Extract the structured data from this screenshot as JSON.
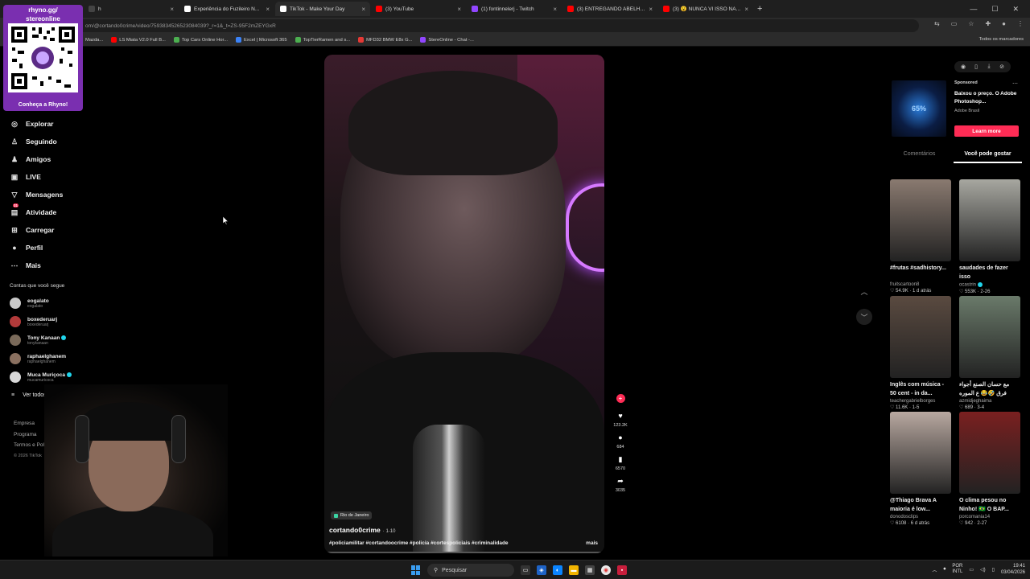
{
  "browser": {
    "tabs": [
      {
        "title": "h",
        "color": "#444444",
        "active": false
      },
      {
        "title": "Experiência do Fuzileiro N...",
        "color": "#ffffff",
        "active": false,
        "icon": "tiktok-icon"
      },
      {
        "title": "TikTok - Make Your Day",
        "color": "#ffffff",
        "active": true,
        "icon": "tiktok-icon"
      },
      {
        "title": "(3) YouTube",
        "color": "#ff0000",
        "active": false,
        "icon": "youtube-icon"
      },
      {
        "title": "(1) fontinnelerj - Twitch",
        "color": "#9146ff",
        "active": false,
        "icon": "twitch-icon"
      },
      {
        "title": "(3) ENTREGANDO ABELHAS, S...",
        "color": "#ff0000",
        "active": false,
        "icon": "youtube-icon"
      },
      {
        "title": "(3) 😮 NUNCA VI ISSO NA EXI...",
        "color": "#ff0000",
        "active": false,
        "icon": "youtube-icon"
      }
    ],
    "url": "om/@cortando0crime/video/7593834526523084039?_r=1&_t=ZS-95F2mZEYGxR",
    "bookmarks": [
      {
        "label": "Mazda...",
        "color": "#888888"
      },
      {
        "label": "LS Miata V2.0 Full B...",
        "color": "#ff0000"
      },
      {
        "label": "Top Cars Online Hor...",
        "color": "#4caf50"
      },
      {
        "label": "Excel | Microsoft 365",
        "color": "#3b82f6"
      },
      {
        "label": "TopTierRamen and s...",
        "color": "#4caf50"
      },
      {
        "label": "MFD32 BMW E8x G...",
        "color": "#e53935"
      },
      {
        "label": "StereOnline - Chat -...",
        "color": "#9146ff"
      }
    ],
    "bookmarks_right": "Todos os marcadores"
  },
  "qr_overlay": {
    "title_line1": "rhyno.gg/",
    "title_line2": "stereonline",
    "caption": "Conheça a Rhyno!"
  },
  "nav": {
    "items": [
      {
        "label": "Explorar",
        "icon": "compass-icon",
        "glyph": "◎"
      },
      {
        "label": "Seguindo",
        "icon": "following-icon",
        "glyph": "♙"
      },
      {
        "label": "Amigos",
        "icon": "friends-icon",
        "glyph": "♟"
      },
      {
        "label": "LIVE",
        "icon": "live-icon",
        "glyph": "▣"
      },
      {
        "label": "Mensagens",
        "icon": "messages-icon",
        "glyph": "▽"
      },
      {
        "label": "Atividade",
        "icon": "activity-icon",
        "glyph": "▤",
        "badge": "31"
      },
      {
        "label": "Carregar",
        "icon": "upload-icon",
        "glyph": "⊞"
      },
      {
        "label": "Perfil",
        "icon": "profile-icon",
        "glyph": "●"
      },
      {
        "label": "Mais",
        "icon": "more-icon",
        "glyph": "⋯"
      }
    ],
    "following_title": "Contas que você segue",
    "following": [
      {
        "name": "eogalato",
        "handle": "eogalato",
        "verified": false,
        "color": "#c9c9c9"
      },
      {
        "name": "boxederuarj",
        "handle": "boxederuarj",
        "verified": false,
        "color": "#b23a3a"
      },
      {
        "name": "Tony Kanaan",
        "handle": "tonykanaan",
        "verified": true,
        "color": "#7a6a5a"
      },
      {
        "name": "raphaelghanem",
        "handle": "raphaelghanem",
        "verified": false,
        "color": "#8a7060"
      },
      {
        "name": "Muca Muriçoca",
        "handle": "mucamuricoca",
        "verified": true,
        "color": "#d8d8d8"
      }
    ],
    "see_all": "Ver todos",
    "footer": [
      "Empresa",
      "Programa",
      "Termos e Políticas"
    ],
    "copyright": "© 2026 TikTok"
  },
  "video": {
    "location": "Rio de Janeiro",
    "author": "cortando0crime",
    "date": "· 1-10",
    "hashtags": "#policiamilitar #cortandoocrime #policia #cortespoliciais #criminalidade",
    "more": "mais",
    "progress": 0.0
  },
  "actions": [
    {
      "name": "like",
      "icon": "heart-icon",
      "glyph": "♥",
      "count": "123.2K"
    },
    {
      "name": "comment",
      "icon": "comment-icon",
      "glyph": "●",
      "count": "684"
    },
    {
      "name": "save",
      "icon": "bookmark-icon",
      "glyph": "▮",
      "count": "6570"
    },
    {
      "name": "share",
      "icon": "share-icon",
      "glyph": "➦",
      "count": "3035"
    }
  ],
  "right_panel": {
    "ad": {
      "sponsored": "Sponsored",
      "title": "Baixou o preço. O Adobe Photoshop...",
      "brand": "Adobe Brasil",
      "button": "Learn more",
      "thumb_text": "65%"
    },
    "tabs": [
      "Comentários",
      "Você pode gostar"
    ],
    "videos": [
      {
        "title": "#frutas #sadhistory...",
        "author": "fruitscartoon8",
        "stats": "♡ 54.9K · 1 d atrás",
        "bg": "#8a7a70"
      },
      {
        "title": "saudades de fazer isso",
        "author": "ocastrin",
        "verified": true,
        "stats": "♡ 553K · 2-26",
        "bg": "#a7a7a0"
      },
      {
        "title": "Inglês com música - 50 cent - in da...",
        "author": "teachergabrielborges",
        "stats": "♡ 11.6K · 1-5",
        "bg": "#5a4a40"
      },
      {
        "title": "مع حسان الصنع أجواء فرق 🤣😂 ع الموره",
        "author": "azmidjeghaima",
        "stats": "♡ 689 · 3-4",
        "bg": "#6a7a6a"
      },
      {
        "title": "@Thiago Brava A maioria é low...",
        "author": "donodosclips",
        "stats": "♡ 6108 · 6 d atrás",
        "bg": "#b8a8a0"
      },
      {
        "title": "O clima pesou no Ninho! 🇧🇷 O BAP...",
        "author": "porcomania14",
        "stats": "♡ 942 · 2-27",
        "bg": "#7a2020"
      }
    ]
  },
  "taskbar": {
    "search": "Pesquisar",
    "lang1": "POR",
    "lang2": "INTL",
    "time": "19:41",
    "date": "03/04/2026"
  }
}
